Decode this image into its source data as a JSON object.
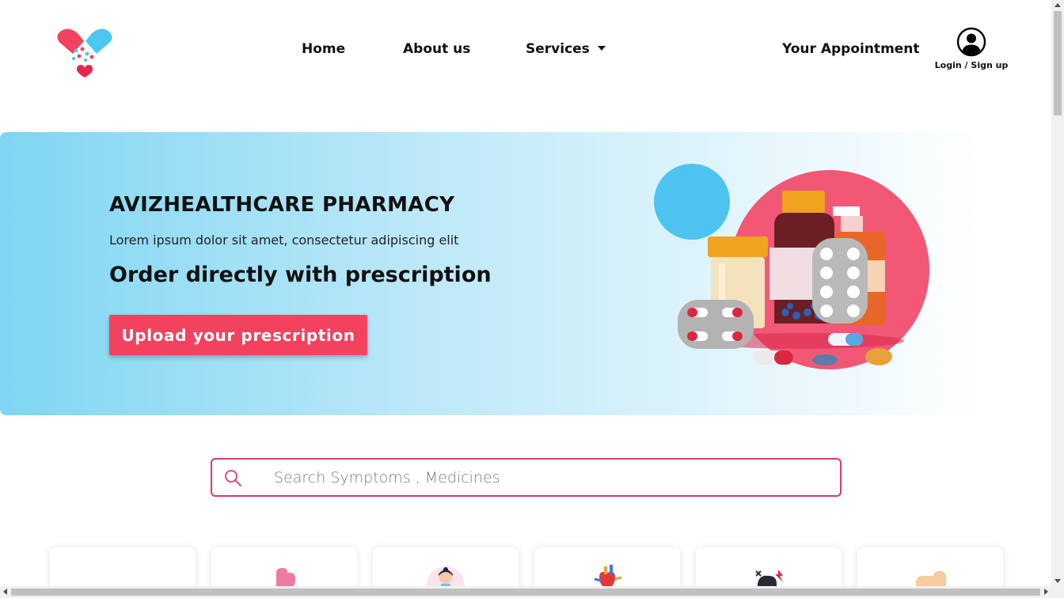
{
  "brand": {
    "logo_icon": "heart-pill-logo-icon"
  },
  "nav": {
    "home": "Home",
    "about": "About us",
    "services": "Services",
    "appointment": "Your Appointment",
    "login": "Login / Sign up"
  },
  "hero": {
    "title": "AVIZHEALTHCARE PHARMACY",
    "subtitle": "Lorem ipsum dolor sit amet, consectetur adipiscing elit",
    "tagline": "Order directly with prescription",
    "cta": "Upload your prescription",
    "illustration": "medicine-bottles-illustration"
  },
  "search": {
    "placeholder": "Search Symptoms , Medicines"
  },
  "categories": [
    {
      "icon": "blank-icon"
    },
    {
      "icon": "stomach-icon"
    },
    {
      "icon": "woman-face-icon"
    },
    {
      "icon": "heart-organ-icon"
    },
    {
      "icon": "injury-icon"
    },
    {
      "icon": "skin-icon"
    }
  ],
  "colors": {
    "accent": "#f2425e",
    "search_border": "#d93a6b",
    "hero_gradient_start": "#7fd6f2"
  }
}
